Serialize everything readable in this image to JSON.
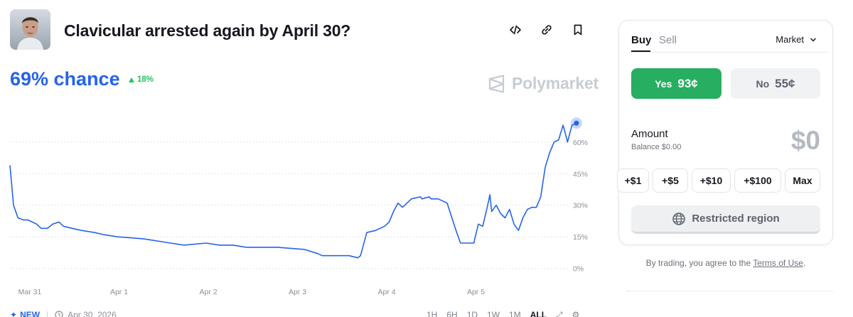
{
  "header": {
    "title": "Clavicular arrested again by April 30?",
    "chance": "69% chance",
    "change": "18%",
    "brand": "Polymarket"
  },
  "chart_data": {
    "type": "line",
    "x_unit": "days since Mar 31, 00:00",
    "y_unit": "percent",
    "ylim": [
      0,
      69
    ],
    "ticks_y": [
      "0%",
      "15%",
      "30%",
      "45%",
      "60%"
    ],
    "ticks_x": [
      "Mar 31",
      "Apr 1",
      "Apr 2",
      "Apr 3",
      "Apr 4",
      "Apr 5"
    ],
    "grid": true,
    "series": [
      {
        "color": "#2563eb",
        "x": [
          0.0,
          0.04,
          0.09,
          0.15,
          0.2,
          0.3,
          0.35,
          0.42,
          0.48,
          0.55,
          0.6,
          0.7,
          0.8,
          0.95,
          1.05,
          1.2,
          1.5,
          1.8,
          1.95,
          2.2,
          2.35,
          2.5,
          2.65,
          3.0,
          3.3,
          3.45,
          3.5,
          3.6,
          3.8,
          3.9,
          3.93,
          4.0,
          4.1,
          4.2,
          4.25,
          4.3,
          4.35,
          4.4,
          4.5,
          4.6,
          4.62,
          4.7,
          4.72,
          4.8,
          4.9,
          5.0,
          5.05,
          5.08,
          5.12,
          5.15,
          5.2,
          5.25,
          5.3,
          5.35,
          5.38,
          5.4,
          5.45,
          5.5,
          5.55,
          5.6,
          5.65,
          5.7,
          5.75,
          5.8,
          5.85,
          5.9,
          5.95,
          6.0,
          6.05,
          6.1,
          6.15,
          6.2,
          6.22,
          6.25,
          6.3,
          6.35
        ],
        "y": [
          49,
          30,
          24,
          23,
          23,
          21,
          19,
          19,
          21,
          22,
          20,
          19,
          18,
          17,
          16,
          15,
          14,
          12,
          11,
          12,
          11,
          11,
          10,
          10,
          9,
          7,
          6,
          6,
          6,
          5,
          6,
          17,
          18,
          20,
          22,
          27,
          31,
          29,
          33,
          34,
          33,
          34,
          33,
          33,
          31,
          18,
          12,
          12,
          12,
          12,
          12,
          21,
          20,
          29,
          35,
          27,
          30,
          26,
          24,
          28,
          21,
          18,
          24,
          28,
          29,
          29,
          34,
          48,
          55,
          60,
          61,
          68,
          65,
          60,
          68,
          69
        ]
      }
    ]
  },
  "footer": {
    "new_label": "NEW",
    "date": "Apr 30, 2026",
    "ranges": [
      "1H",
      "6H",
      "1D",
      "1W",
      "1M",
      "ALL"
    ]
  },
  "trade": {
    "tab_buy": "Buy",
    "tab_sell": "Sell",
    "order_type": "Market",
    "yes_label": "Yes",
    "yes_price": "93¢",
    "no_label": "No",
    "no_price": "55¢",
    "amount_label": "Amount",
    "balance": "Balance $0.00",
    "amount_value": "$0",
    "quick": [
      "+$1",
      "+$5",
      "+$10",
      "+$100",
      "Max"
    ],
    "restricted": "Restricted region",
    "terms_prefix": "By trading, you agree to the ",
    "terms_link": "Terms of Use",
    "terms_suffix": "."
  },
  "colors": {
    "accent": "#2563eb",
    "up": "#22c55e",
    "yes": "#27ae60"
  }
}
